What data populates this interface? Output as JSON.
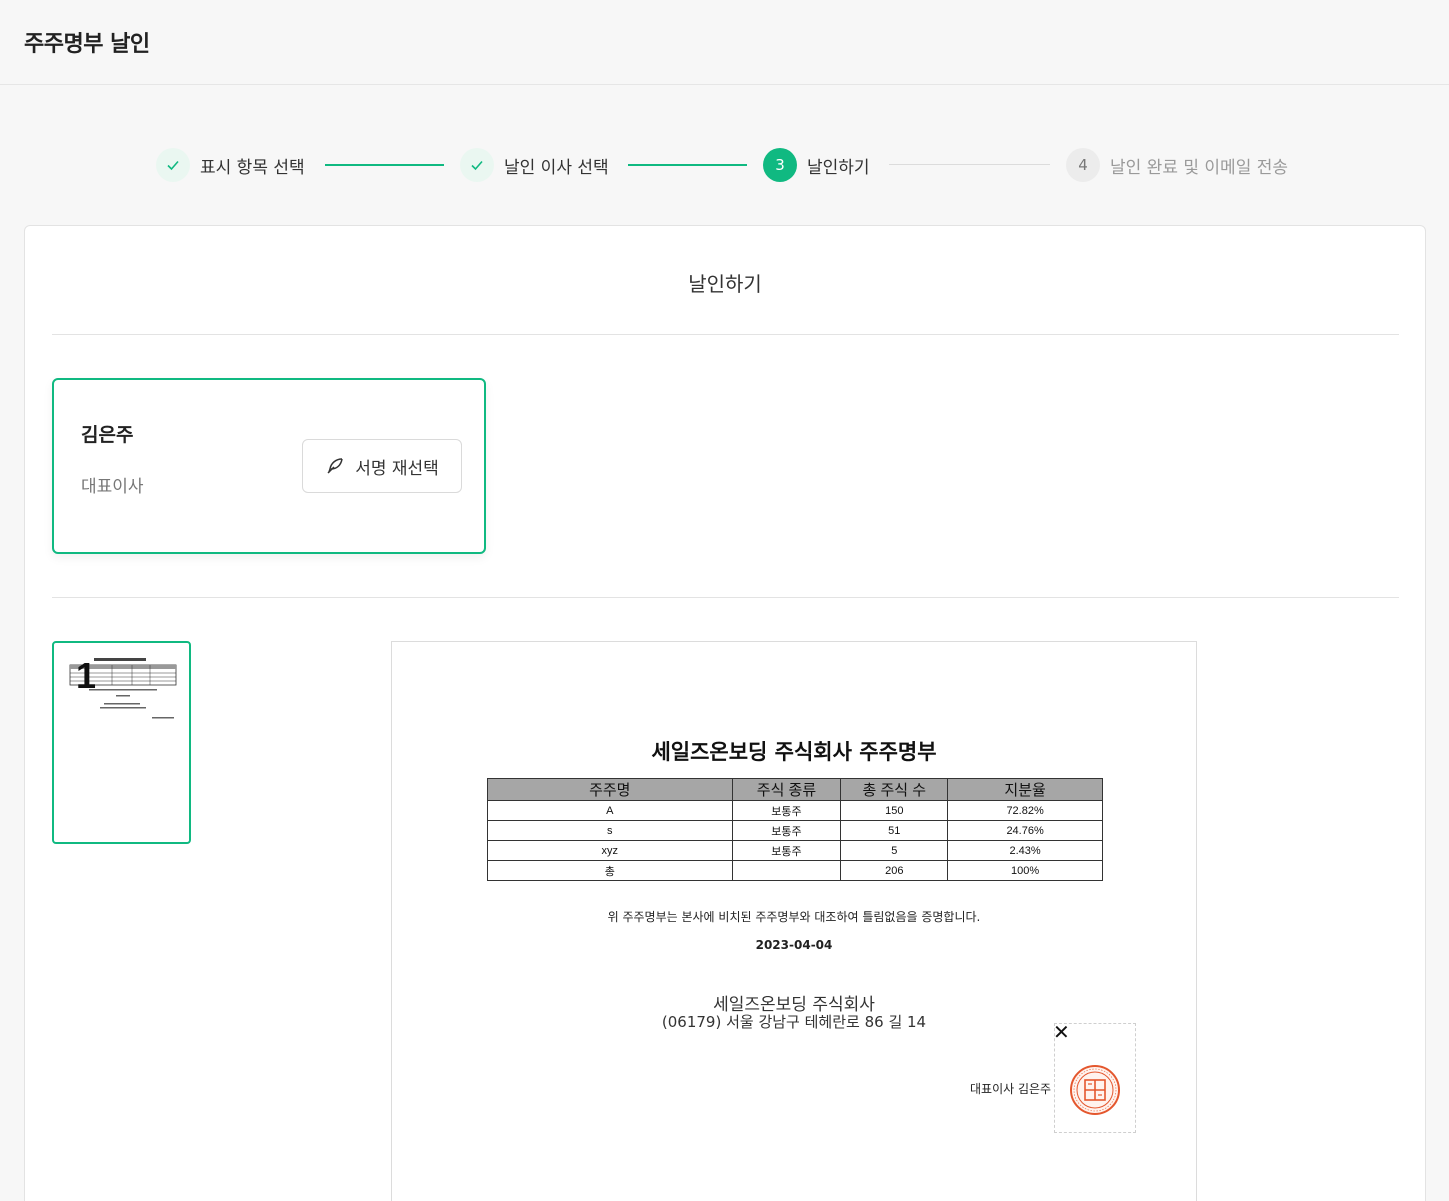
{
  "header": {
    "title": "주주명부 날인"
  },
  "steps": [
    {
      "number": "1",
      "label": "표시 항목 선택",
      "state": "done"
    },
    {
      "number": "2",
      "label": "날인 이사 선택",
      "state": "done"
    },
    {
      "number": "3",
      "label": "날인하기",
      "state": "active"
    },
    {
      "number": "4",
      "label": "날인 완료 및 이메일 전송",
      "state": "todo"
    }
  ],
  "main": {
    "title": "날인하기",
    "signer": {
      "name": "김은주",
      "role": "대표이사",
      "resign_label": "서명 재선택"
    },
    "thumbnail": {
      "page_number": "1"
    }
  },
  "document": {
    "title": "세일즈온보딩 주식회사 주주명부",
    "columns": [
      "주주명",
      "주식 종류",
      "총 주식 수",
      "지분율"
    ],
    "rows": [
      [
        "A",
        "보통주",
        "150",
        "72.82%"
      ],
      [
        "s",
        "보통주",
        "51",
        "24.76%"
      ],
      [
        "xyz",
        "보통주",
        "5",
        "2.43%"
      ],
      [
        "총",
        "",
        "206",
        "100%"
      ]
    ],
    "statement": "위 주주명부는 본사에 비치된 주주명부와 대조하여 틀림없음을 증명합니다.",
    "date": "2023-04-04",
    "company": "세일즈온보딩 주식회사",
    "address": "(06179) 서울 강남구 테헤란로 86 길 14",
    "signer_label": "대표이사  김은주",
    "stamp_close": "✕"
  },
  "colors": {
    "accent": "#10b981",
    "stamp": "#e4572e"
  }
}
